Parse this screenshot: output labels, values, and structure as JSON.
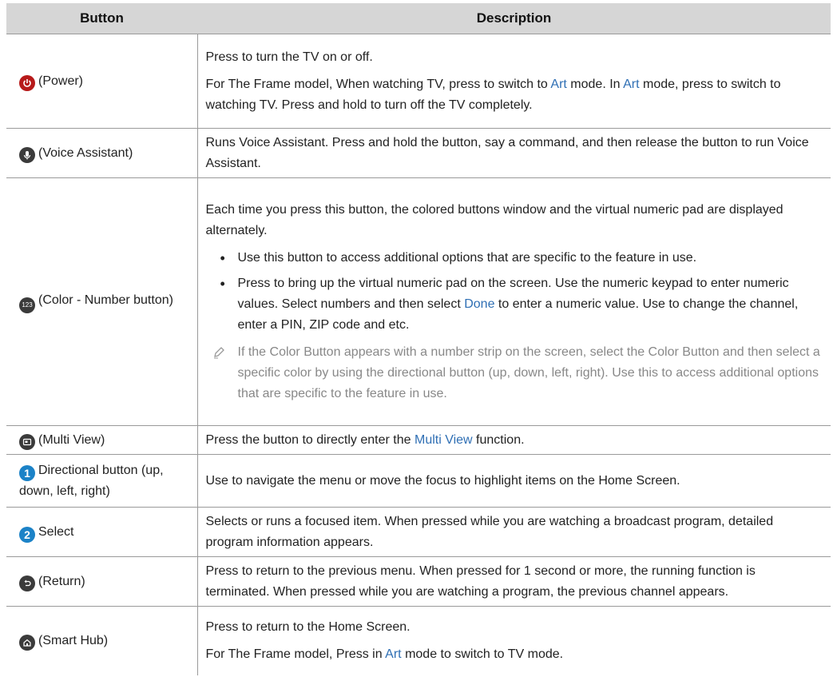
{
  "header": {
    "col_button": "Button",
    "col_description": "Description"
  },
  "rows": [
    {
      "icon": "power-icon",
      "label": "(Power)",
      "p1": "Press to turn the TV on or off.",
      "p2a": "For The Frame model, When watching TV, press to switch to ",
      "p2b": "Art",
      "p2c": " mode. In ",
      "p2d": "Art",
      "p2e": " mode, press to switch to watching TV. Press and hold to turn off the TV completely."
    },
    {
      "icon": "microphone-icon",
      "label": "(Voice Assistant)",
      "p1": "Runs Voice Assistant. Press and hold the button, say a command, and then release the button to run Voice Assistant."
    },
    {
      "icon": "color-number-icon",
      "icon_text": "123",
      "label": "(Color - Number button)",
      "p1": "Each time you press this button, the colored buttons window and the virtual numeric pad are displayed alternately.",
      "b1": "Use this button to access additional options that are specific to the feature in use.",
      "b2a": "Press to bring up the virtual numeric pad on the screen. Use the numeric keypad to enter numeric values. Select numbers and then select ",
      "b2b": "Done",
      "b2c": " to enter a numeric value. Use to change the channel, enter a PIN, ZIP code and etc.",
      "note": "If the Color Button appears with a number strip on the screen, select the Color Button and then select a specific color by using the directional button (up, down, left, right). Use this to access additional options that are specific to the feature in use."
    },
    {
      "icon": "multi-view-icon",
      "label": "(Multi View)",
      "p1a": "Press the button to directly enter the ",
      "p1b": "Multi View",
      "p1c": " function."
    },
    {
      "icon": "number-one-icon",
      "icon_text": "1",
      "label": "Directional button (up, down, left, right)",
      "p1": "Use to navigate the menu or move the focus to highlight items on the Home Screen."
    },
    {
      "icon": "number-two-icon",
      "icon_text": "2",
      "label": "Select",
      "p1": "Selects or runs a focused item. When pressed while you are watching a broadcast program, detailed program information appears."
    },
    {
      "icon": "return-icon",
      "label": "(Return)",
      "p1": "Press to return to the previous menu. When pressed for 1 second or more, the running function is terminated. When pressed while you are watching a program, the previous channel appears."
    },
    {
      "icon": "home-icon",
      "label": "(Smart Hub)",
      "p1": "Press to return to the Home Screen.",
      "p2a": "For The Frame model, Press in ",
      "p2b": "Art",
      "p2c": " mode to switch to TV mode."
    }
  ]
}
